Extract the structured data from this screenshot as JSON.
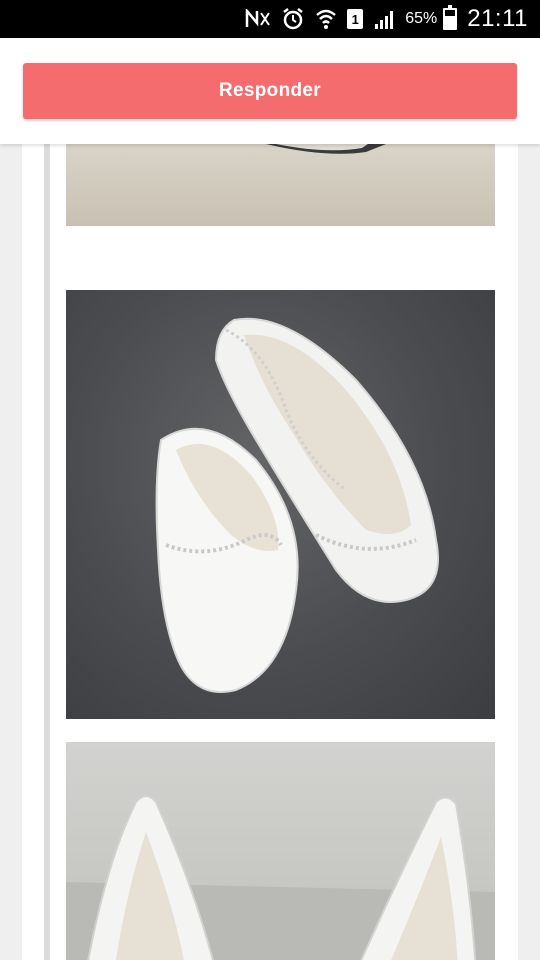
{
  "status_bar": {
    "sim_slot": "1",
    "battery_percent": "65%",
    "battery_level": 0.65,
    "clock": "21:11",
    "icons": [
      "nfc-icon",
      "alarm-icon",
      "wifi-icon",
      "sim-icon",
      "signal-icon",
      "battery-icon"
    ]
  },
  "header": {
    "reply_label": "Responder",
    "accent_color": "#f46c6e"
  },
  "content": {
    "images": [
      {
        "name": "shoe-photo-partial",
        "subject": "bridal flat shoe (cropped top)"
      },
      {
        "name": "shoe-photo-crystal-flats",
        "subject": "white pointed flats with crystal trim"
      },
      {
        "name": "shoe-photo-white-flats",
        "subject": "white pointed flats"
      }
    ]
  }
}
